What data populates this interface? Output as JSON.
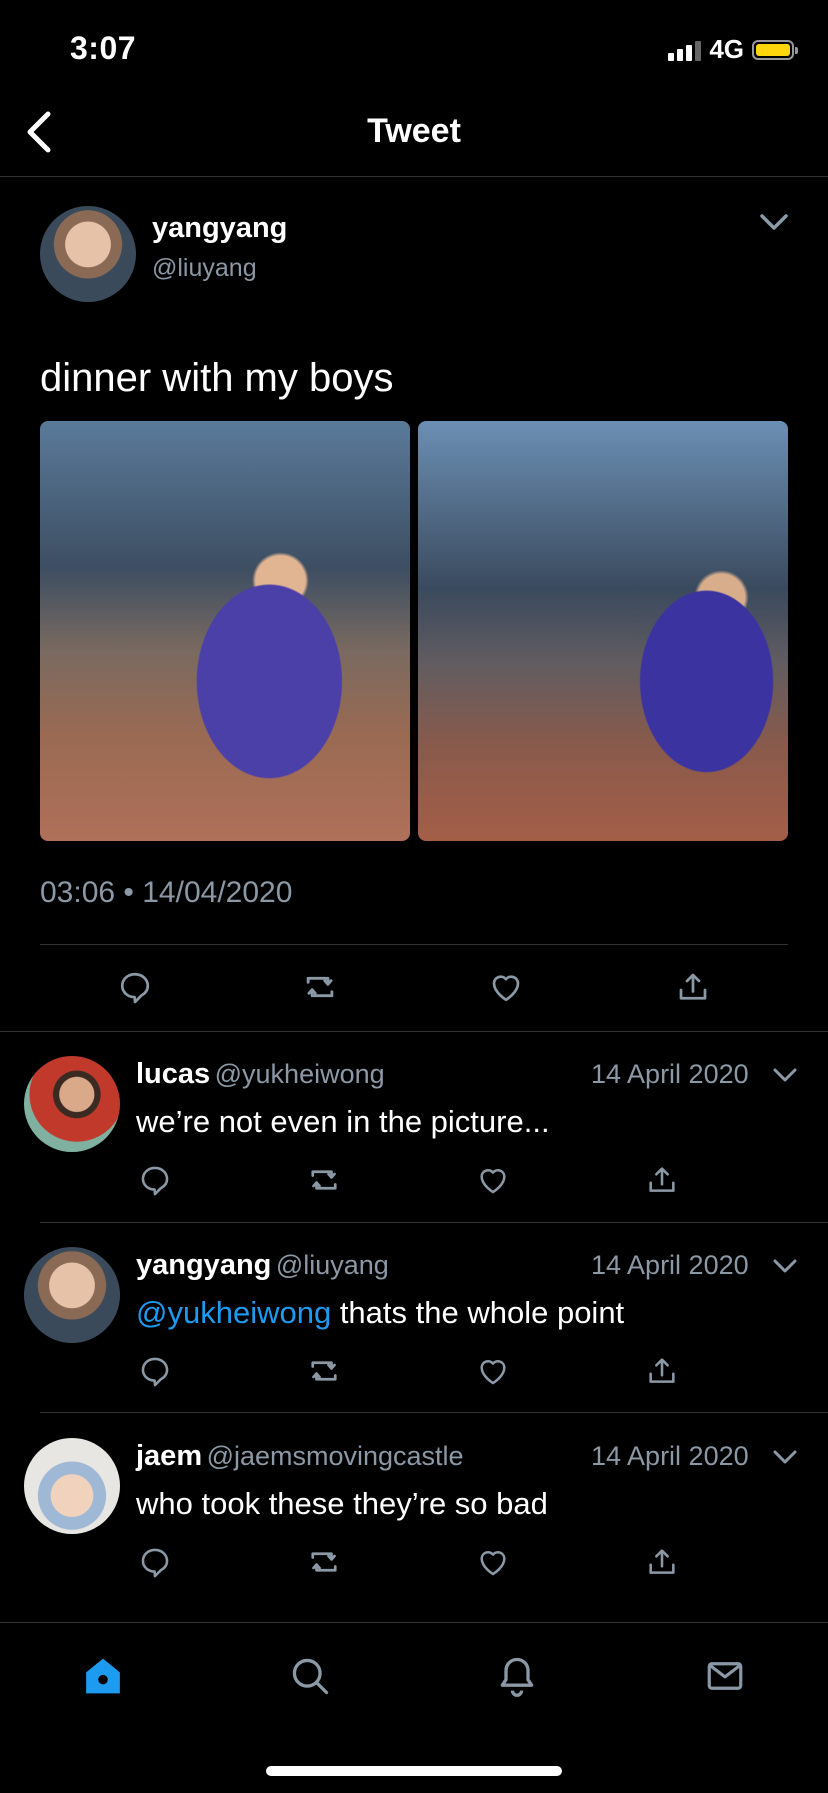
{
  "status_bar": {
    "time": "3:07",
    "network": "4G"
  },
  "header": {
    "title": "Tweet"
  },
  "tweet": {
    "author_name": "yangyang",
    "author_handle": "@liuyang",
    "text": "dinner with my boys",
    "timestamp": "03:06 • 14/04/2020",
    "photos": [
      "photo-1",
      "photo-2"
    ]
  },
  "replies": [
    {
      "name": "lucas",
      "handle": "@yukheiwong",
      "date": "14 April 2020",
      "mention": "",
      "text": "we’re not even in the picture..."
    },
    {
      "name": "yangyang",
      "handle": "@liuyang",
      "date": "14 April 2020",
      "mention": "@yukheiwong",
      "text": " thats the whole point"
    },
    {
      "name": "jaem",
      "handle": "@jaemsmovingcastle",
      "date": "14 April 2020",
      "mention": "",
      "text": "who took these they’re so bad"
    }
  ],
  "colors": {
    "accent": "#1d9bf0",
    "background": "#000000",
    "muted": "#8b98a5",
    "battery": "#ffd60a"
  },
  "icons": [
    "back-icon",
    "chevron-down-icon",
    "reply-icon",
    "retweet-icon",
    "like-icon",
    "share-icon",
    "home-icon",
    "search-icon",
    "notifications-icon",
    "messages-icon"
  ]
}
